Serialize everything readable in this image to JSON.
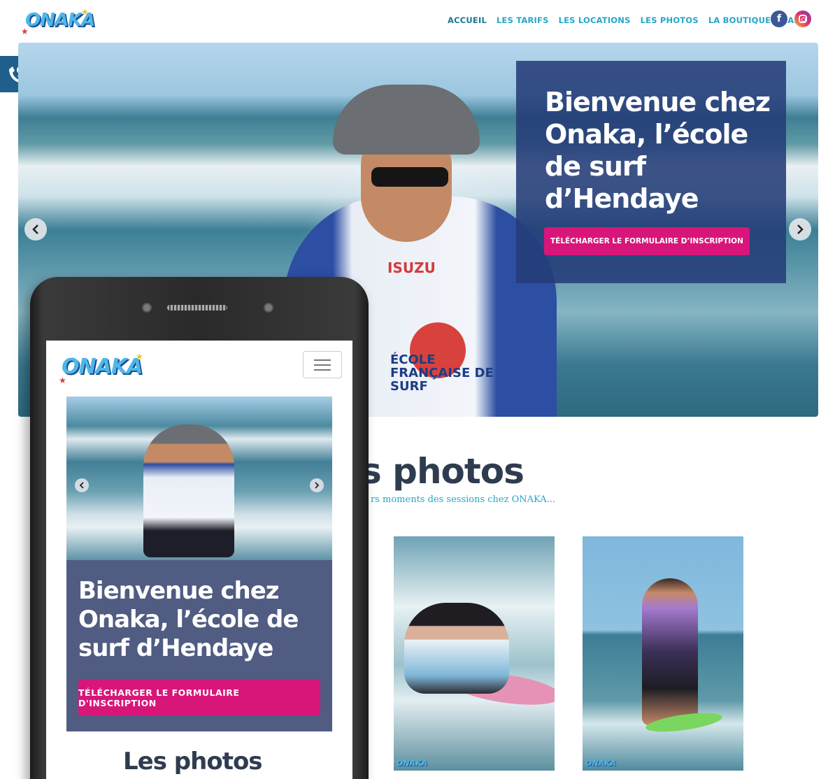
{
  "site": {
    "logo_text": "ONAKA"
  },
  "nav": {
    "items": [
      {
        "label": "ACCUEIL"
      },
      {
        "label": "LES TARIFS"
      },
      {
        "label": "LES LOCATIONS"
      },
      {
        "label": "LES PHOTOS"
      },
      {
        "label": "LA BOUTIQUE ONAKA"
      }
    ],
    "facebook_letter": "f"
  },
  "hero": {
    "title": "Bienvenue chez Onaka, l’école de surf d’Hendaye",
    "button_label": "TÉLÉCHARGER LE FORMULAIRE D’INSCRIPTION",
    "shirt_text_1": "ISUZU",
    "shirt_text_2": "ÉCOLE\nFRANÇAISE DE\nSURF"
  },
  "photos_section": {
    "title": "s photos",
    "subtitle": "rs moments des sessions chez ONAKA..."
  },
  "mobile": {
    "logo_text": "ONAKA",
    "hero_title": "Bienvenue chez Onaka, l’école de surf d’Hendaye",
    "button_label": "TÉLÉCHARGER LE FORMULAIRE D'INSCRIPTION",
    "section_title": "Les photos"
  },
  "colors": {
    "nav": "#27a6c9",
    "hero_box": "#243c78",
    "button": "#d8167a",
    "mobile_box": "#505c82",
    "heading": "#2f3c4f"
  }
}
